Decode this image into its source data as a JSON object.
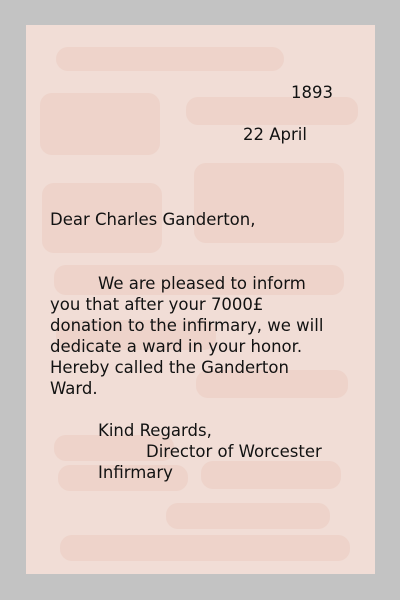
{
  "letter": {
    "year": "1893",
    "date": "22 April",
    "salutation": "Dear Charles Ganderton,",
    "body_lines": [
      "We are pleased to inform",
      "you that after your 7000£",
      "donation to the infirmary, we will",
      "dedicate a ward in your honor.",
      "Hereby called the Ganderton",
      "Ward."
    ],
    "closing": "Kind Regards,",
    "signature_lines": [
      "Director of Worcester",
      "Infirmary"
    ]
  }
}
